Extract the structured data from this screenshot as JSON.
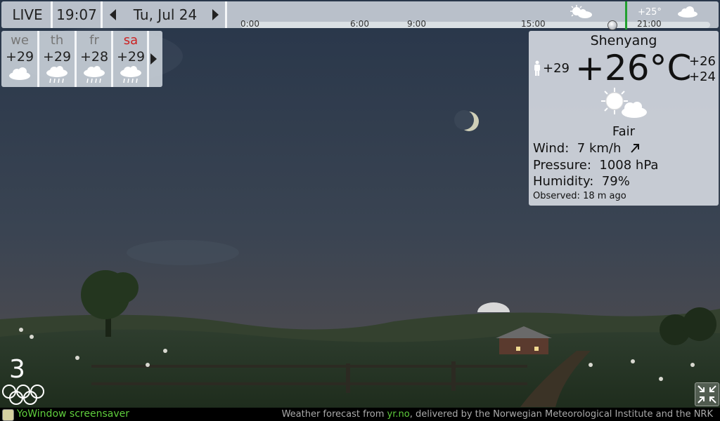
{
  "topbar": {
    "live_label": "LIVE",
    "time": "19:07",
    "date": "Tu, Jul 24",
    "timeline_ticks": [
      "0:00",
      "6:00",
      "9:00",
      "15:00",
      "21:00"
    ],
    "timeline_high_temp": "+25°",
    "icons": [
      "partly-sunny-icon",
      "cloud-icon"
    ]
  },
  "forecast": {
    "days": [
      {
        "name": "we",
        "temp": "+29",
        "icon": "cloud-icon",
        "weekend": false
      },
      {
        "name": "th",
        "temp": "+29",
        "icon": "rain-icon",
        "weekend": false
      },
      {
        "name": "fr",
        "temp": "+28",
        "icon": "rain-icon",
        "weekend": false
      },
      {
        "name": "sa",
        "temp": "+29",
        "icon": "rain-icon",
        "weekend": true
      }
    ],
    "next_icon": "chevron-right-icon"
  },
  "current": {
    "city": "Shenyang",
    "temperature": "+26°C",
    "feels_like": "+29",
    "high": "+26",
    "low": "+24",
    "condition": "Fair",
    "wind_label": "Wind:",
    "wind_value": "7 km/h",
    "pressure_label": "Pressure:",
    "pressure_value": "1008 hPa",
    "humidity_label": "Humidity:",
    "humidity_value": "79%",
    "observed_label": "Observed:",
    "observed_value": "18 m ago"
  },
  "olympics": {
    "count": "3"
  },
  "footer": {
    "brand": "YoWindow screensaver",
    "credit_prefix": "Weather forecast from ",
    "credit_link": "yr.no",
    "credit_suffix": ", delivered by the Norwegian Meteorological Institute and the NRK"
  },
  "colors": {
    "accent_green": "#5fce3c",
    "weekend_red": "#cc2222",
    "now_line": "#22a030"
  }
}
